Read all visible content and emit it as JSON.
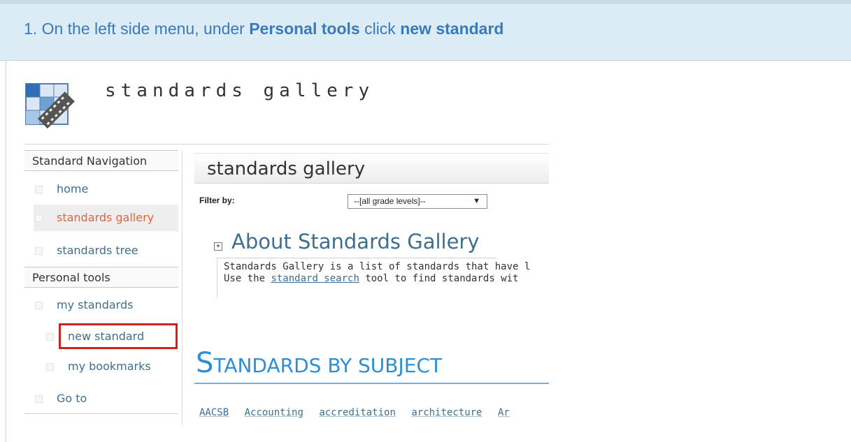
{
  "instruction": {
    "step": "1.",
    "prefix": "On the left side menu, under",
    "section": "Personal tools",
    "middle": "click",
    "target": "new standard"
  },
  "site": {
    "title": "standards gallery"
  },
  "nav": {
    "standard_header": "Standard Navigation",
    "items": [
      "home",
      "standards gallery",
      "standards tree"
    ],
    "personal_header": "Personal tools",
    "personal_items": [
      "my standards",
      "new standard",
      "my bookmarks",
      "Go to"
    ]
  },
  "main": {
    "title": "standards gallery",
    "filter_label": "Filter by:",
    "filter_value": "--[all grade levels]--",
    "about_title": "About Standards Gallery",
    "about_line1": "Standards Gallery is a list of standards that have l",
    "about_line2_prefix": "Use the",
    "about_link": "standard search",
    "about_line2_suffix": "tool to find standards wit",
    "subject_title_first": "S",
    "subject_title_rest": "TANDARDS BY SUBJECT",
    "tags": [
      "AACSB",
      "Accounting",
      "accreditation",
      "architecture",
      "Ar"
    ]
  },
  "colors": {
    "accent": "#3a7ab8",
    "active": "#e2623f",
    "highlight": "#cc2222",
    "subject": "#2c8fd4"
  }
}
